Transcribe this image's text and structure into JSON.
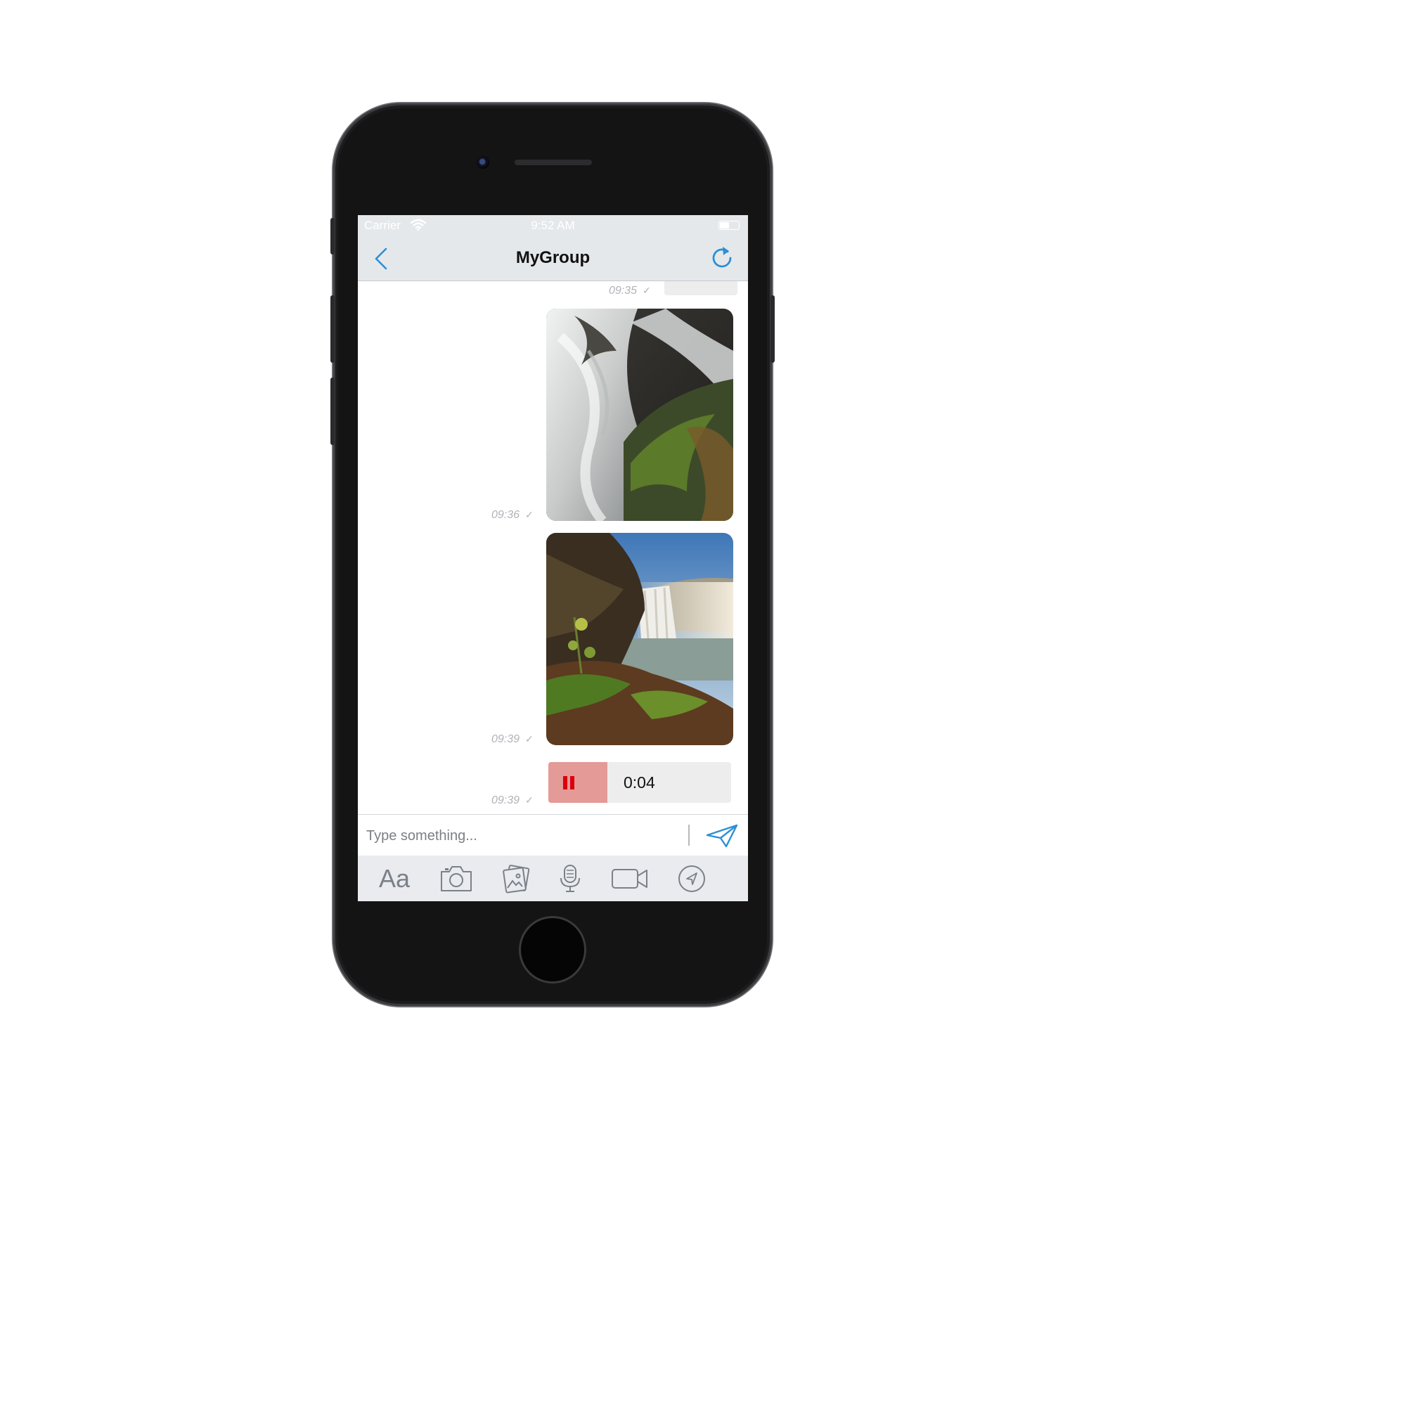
{
  "statusbar": {
    "carrier": "Carrier",
    "time": "9:52 AM"
  },
  "navbar": {
    "title": "MyGroup",
    "back_icon": "chevron-left-icon",
    "refresh_icon": "refresh-icon"
  },
  "messages": [
    {
      "type": "text",
      "time": "09:35",
      "status": "✓"
    },
    {
      "type": "image",
      "time": "09:36",
      "status": "✓",
      "description_icon": "waterfall-photo"
    },
    {
      "type": "image",
      "time": "09:39",
      "status": "✓",
      "description_icon": "waterfall-landscape-photo"
    },
    {
      "type": "audio",
      "time": "09:39",
      "status": "✓",
      "duration": "0:04",
      "playing": true
    }
  ],
  "composer": {
    "placeholder": "Type something...",
    "send_icon": "paper-plane-icon"
  },
  "toolbar": {
    "text_label": "Aa",
    "icons": [
      "text-format-icon",
      "camera-icon",
      "gallery-icon",
      "microphone-icon",
      "video-camera-icon",
      "location-icon"
    ]
  },
  "colors": {
    "accent": "#2d8fd5",
    "navbar_bg": "#e5e8eb",
    "bubble_bg": "#ededed",
    "pause_bg": "#e49a96",
    "pause_icon": "#d8000c"
  }
}
